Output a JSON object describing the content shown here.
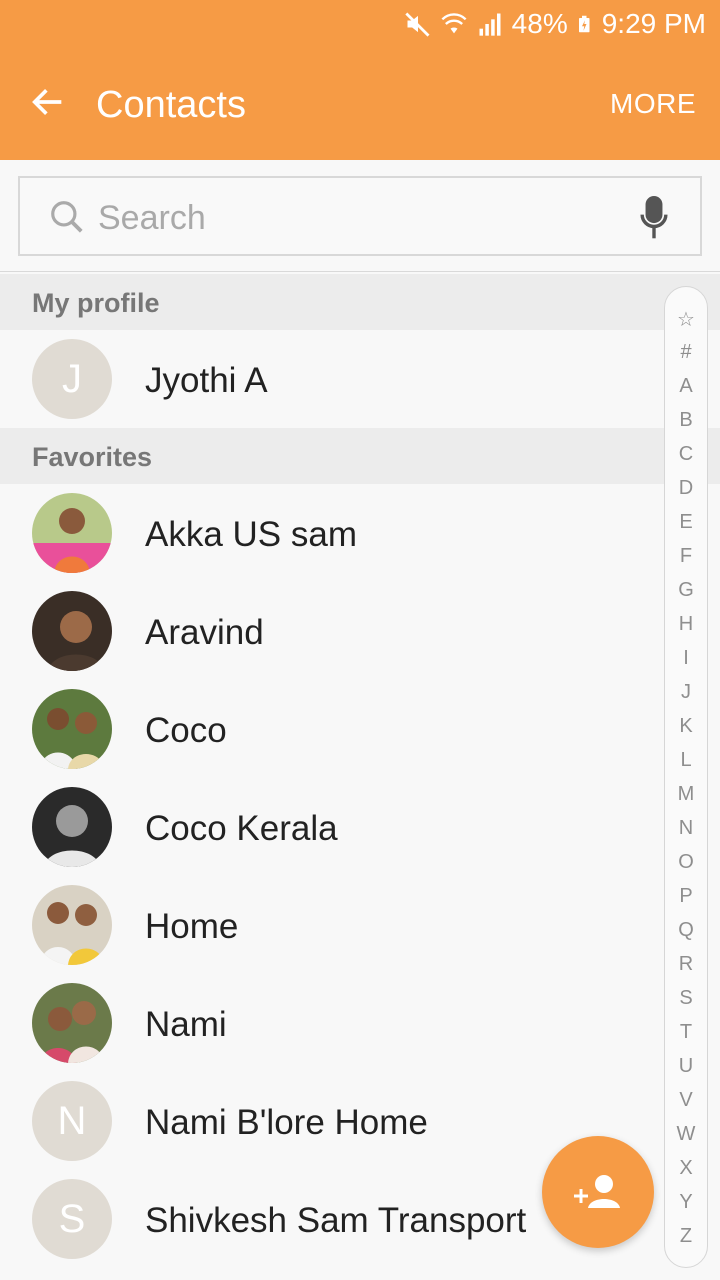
{
  "status": {
    "battery": "48%",
    "time": "9:29 PM"
  },
  "header": {
    "title": "Contacts",
    "more_label": "MORE"
  },
  "search": {
    "placeholder": "Search"
  },
  "sections": {
    "profile": "My profile",
    "favorites": "Favorites"
  },
  "profile": {
    "initial": "J",
    "name": "Jyothi A"
  },
  "favorites": [
    {
      "name": "Akka US sam"
    },
    {
      "name": "Aravind"
    },
    {
      "name": "Coco"
    },
    {
      "name": "Coco Kerala"
    },
    {
      "name": "Home"
    },
    {
      "name": "Nami"
    },
    {
      "name": "Nami B'lore Home",
      "initial": "N"
    },
    {
      "name": "Shivkesh Sam Transport",
      "initial": "S"
    }
  ],
  "index": [
    "☆",
    "#",
    "A",
    "B",
    "C",
    "D",
    "E",
    "F",
    "G",
    "H",
    "I",
    "J",
    "K",
    "L",
    "M",
    "N",
    "O",
    "P",
    "Q",
    "R",
    "S",
    "T",
    "U",
    "V",
    "W",
    "X",
    "Y",
    "Z"
  ],
  "colors": {
    "accent": "#f69b45"
  }
}
